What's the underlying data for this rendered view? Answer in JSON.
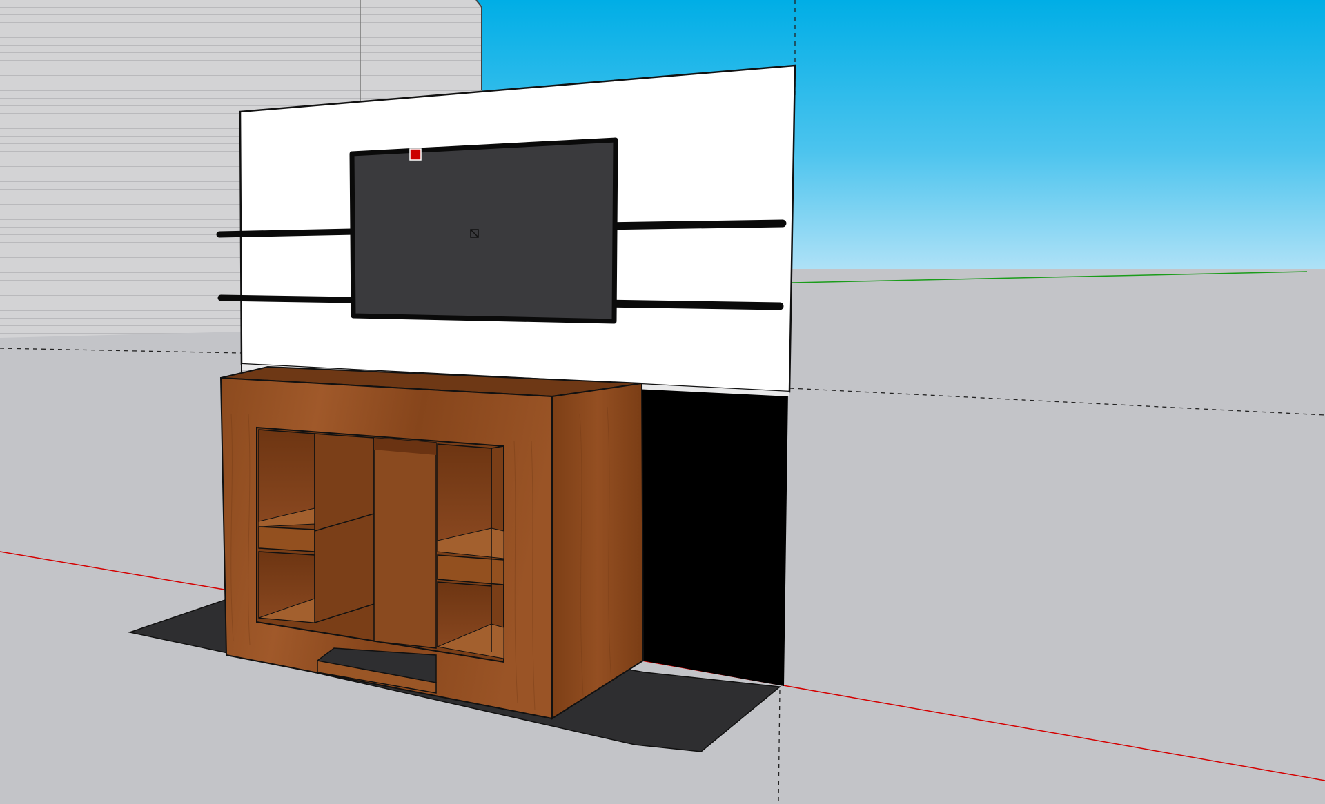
{
  "app": {
    "kind": "3d-modeling-viewport",
    "view": "perspective"
  },
  "scene": {
    "sky_top_color": "#00aee6",
    "sky_bottom_color": "#b4e3f7",
    "ground_color": "#c3c4c8",
    "axis_red_color": "#d40000",
    "axis_green_color": "#1a9c1a",
    "wall_color": "#ffffff",
    "tv_color": "#3a3a3d",
    "cabinet_color": "#8a4a1c",
    "rug_color": "#2e2e30",
    "building_color": "#d2d2d4",
    "selection_marker_color": "#cc0000"
  },
  "objects": [
    {
      "name": "background-building",
      "icon": "building-icon"
    },
    {
      "name": "feature-wall"
    },
    {
      "name": "tv-screen"
    },
    {
      "name": "floating-shelves",
      "count": 4
    },
    {
      "name": "media-cabinet"
    },
    {
      "name": "floor-rug"
    }
  ]
}
